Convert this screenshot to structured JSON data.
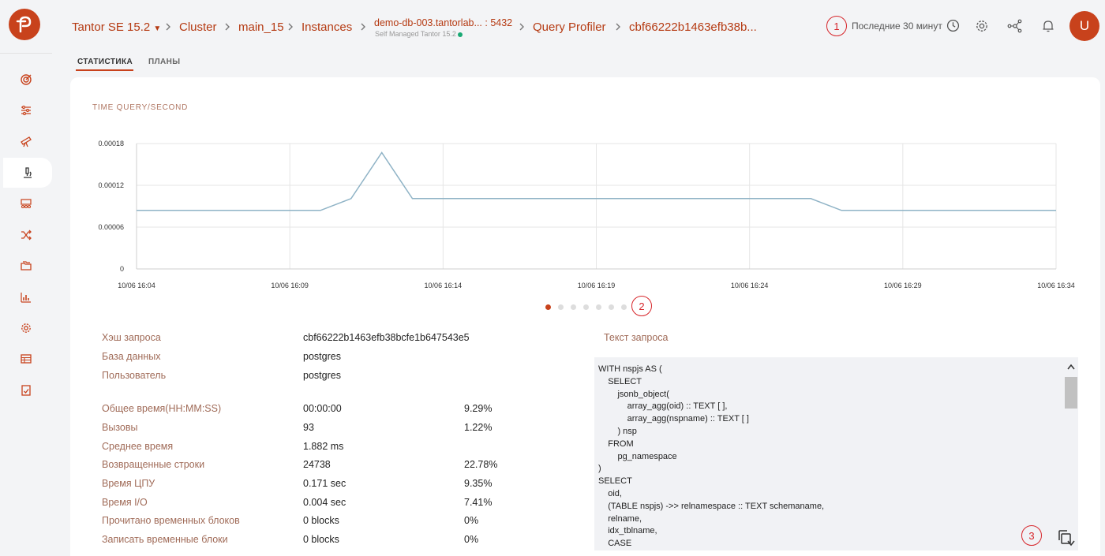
{
  "header": {
    "breadcrumbs": [
      {
        "label": "Tantor SE 15.2"
      },
      {
        "label": "Cluster"
      },
      {
        "label": "main_15"
      },
      {
        "label": "Instances"
      },
      {
        "label": "demo-db-003.tantorlab...",
        "port": ": 5432",
        "sub": "Self Managed Tantor 15.2"
      },
      {
        "label": "Query Profiler"
      },
      {
        "label": "cbf66222b1463efb38b..."
      }
    ],
    "time_range": "Последние 30 минут",
    "avatar": "U",
    "annotations": [
      "1",
      "2",
      "3"
    ]
  },
  "tabs": [
    {
      "label": "СТАТИСТИКА",
      "active": true
    },
    {
      "label": "ПЛАНЫ",
      "active": false
    }
  ],
  "chart_title": "TIME QUERY/SECOND",
  "chart_data": {
    "type": "line",
    "title": "TIME QUERY/SECOND",
    "ylim": [
      0,
      0.00018
    ],
    "yticks": [
      "0.00018",
      "0.00012",
      "0.00006",
      "0"
    ],
    "xticks": [
      "10/06 16:04",
      "10/06 16:09",
      "10/06 16:14",
      "10/06 16:19",
      "10/06 16:24",
      "10/06 16:29",
      "10/06 16:34"
    ],
    "x_minutes": [
      0,
      6,
      7,
      8,
      9,
      22,
      23,
      30
    ],
    "values": [
      8.4e-05,
      8.4e-05,
      0.000101,
      0.000167,
      0.000101,
      0.000101,
      8.4e-05,
      8.4e-05
    ],
    "grid": true,
    "color": "#8fb3c6"
  },
  "pagination": {
    "count": 7,
    "active": 0
  },
  "stats": [
    {
      "label": "Хэш запроса",
      "value": "cbf66222b1463efb38bcfe1b647543e5",
      "pct": ""
    },
    {
      "label": "База данных",
      "value": "postgres",
      "pct": ""
    },
    {
      "label": "Пользователь",
      "value": "postgres",
      "pct": ""
    },
    {
      "label": "Общее время(HH:MM:SS)",
      "value": "00:00:00",
      "pct": "9.29%"
    },
    {
      "label": "Вызовы",
      "value": "93",
      "pct": "1.22%"
    },
    {
      "label": "Среднее время",
      "value": "1.882 ms",
      "pct": ""
    },
    {
      "label": "Возвращенные строки",
      "value": "24738",
      "pct": "22.78%"
    },
    {
      "label": "Время ЦПУ",
      "value": "0.171 sec",
      "pct": "9.35%"
    },
    {
      "label": "Время I/O",
      "value": "0.004 sec",
      "pct": "7.41%"
    },
    {
      "label": "Прочитано временных блоков",
      "value": "0 blocks",
      "pct": "0%"
    },
    {
      "label": "Записать временные блоки",
      "value": "0 blocks",
      "pct": "0%"
    }
  ],
  "query_text_title": "Текст запроса",
  "query_text": "WITH nspjs AS (\n    SELECT\n        jsonb_object(\n            array_agg(oid) :: TEXT [ ],\n            array_agg(nspname) :: TEXT [ ]\n        ) nsp\n    FROM\n        pg_namespace\n)\nSELECT\n    oid,\n    (TABLE nspjs) ->> relnamespace :: TEXT schemaname,\n    relname,\n    idx_tblname,\n    CASE"
}
